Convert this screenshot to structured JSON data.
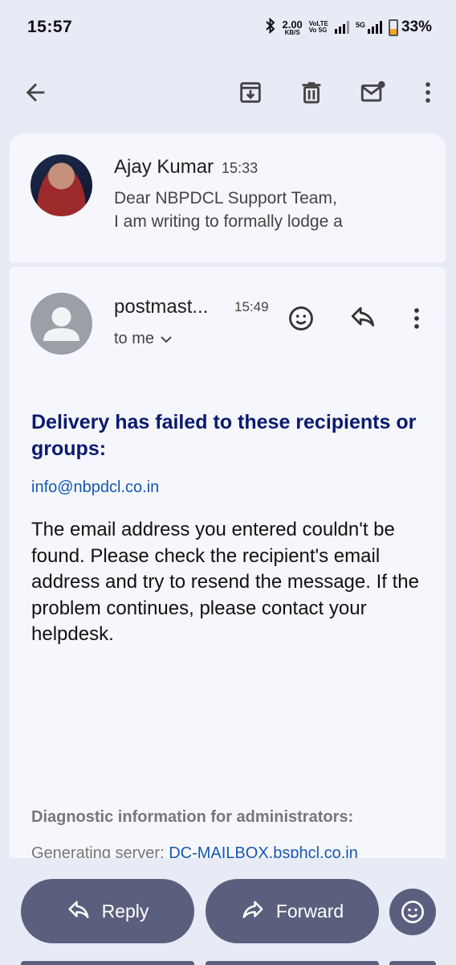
{
  "status_bar": {
    "time": "15:57",
    "net_speed_value": "2.00",
    "net_speed_unit": "KB/S",
    "volte_1": "VoLTE",
    "volte_2": "Vo 5G",
    "network_5g": "5G",
    "battery": "33%"
  },
  "toolbar": {
    "icons": [
      "back-arrow-icon",
      "archive-icon",
      "delete-icon",
      "mark-unread-icon",
      "more-vert-icon"
    ]
  },
  "collapsed_message": {
    "sender": "Ajay Kumar",
    "time": "15:33",
    "snippet_line1": "Dear NBPDCL Support Team,",
    "snippet_line2": "I am writing to formally lodge a"
  },
  "expanded_message": {
    "sender": "postmast...",
    "time": "15:49",
    "to": "to me",
    "heading": "Delivery has failed to these recipients or groups:",
    "recipient": "info@nbpdcl.co.in",
    "body": "The email address you entered couldn't be found. Please check the recipient's email address and try to resend the message. If the problem continues, please contact your helpdesk.",
    "diagnostic_heading": "Diagnostic information for administrators:",
    "generating_server_label": "Generating server: ",
    "generating_server_value": "DC-MAILBOX.bsphcl.co.in"
  },
  "bottom_bar": {
    "reply_label": "Reply",
    "forward_label": "Forward"
  },
  "colors": {
    "background": "#e8eaf6",
    "card": "#f6f7fc",
    "heading": "#0a1a6e",
    "link": "#1558b0",
    "pill": "#5a5f7e"
  }
}
